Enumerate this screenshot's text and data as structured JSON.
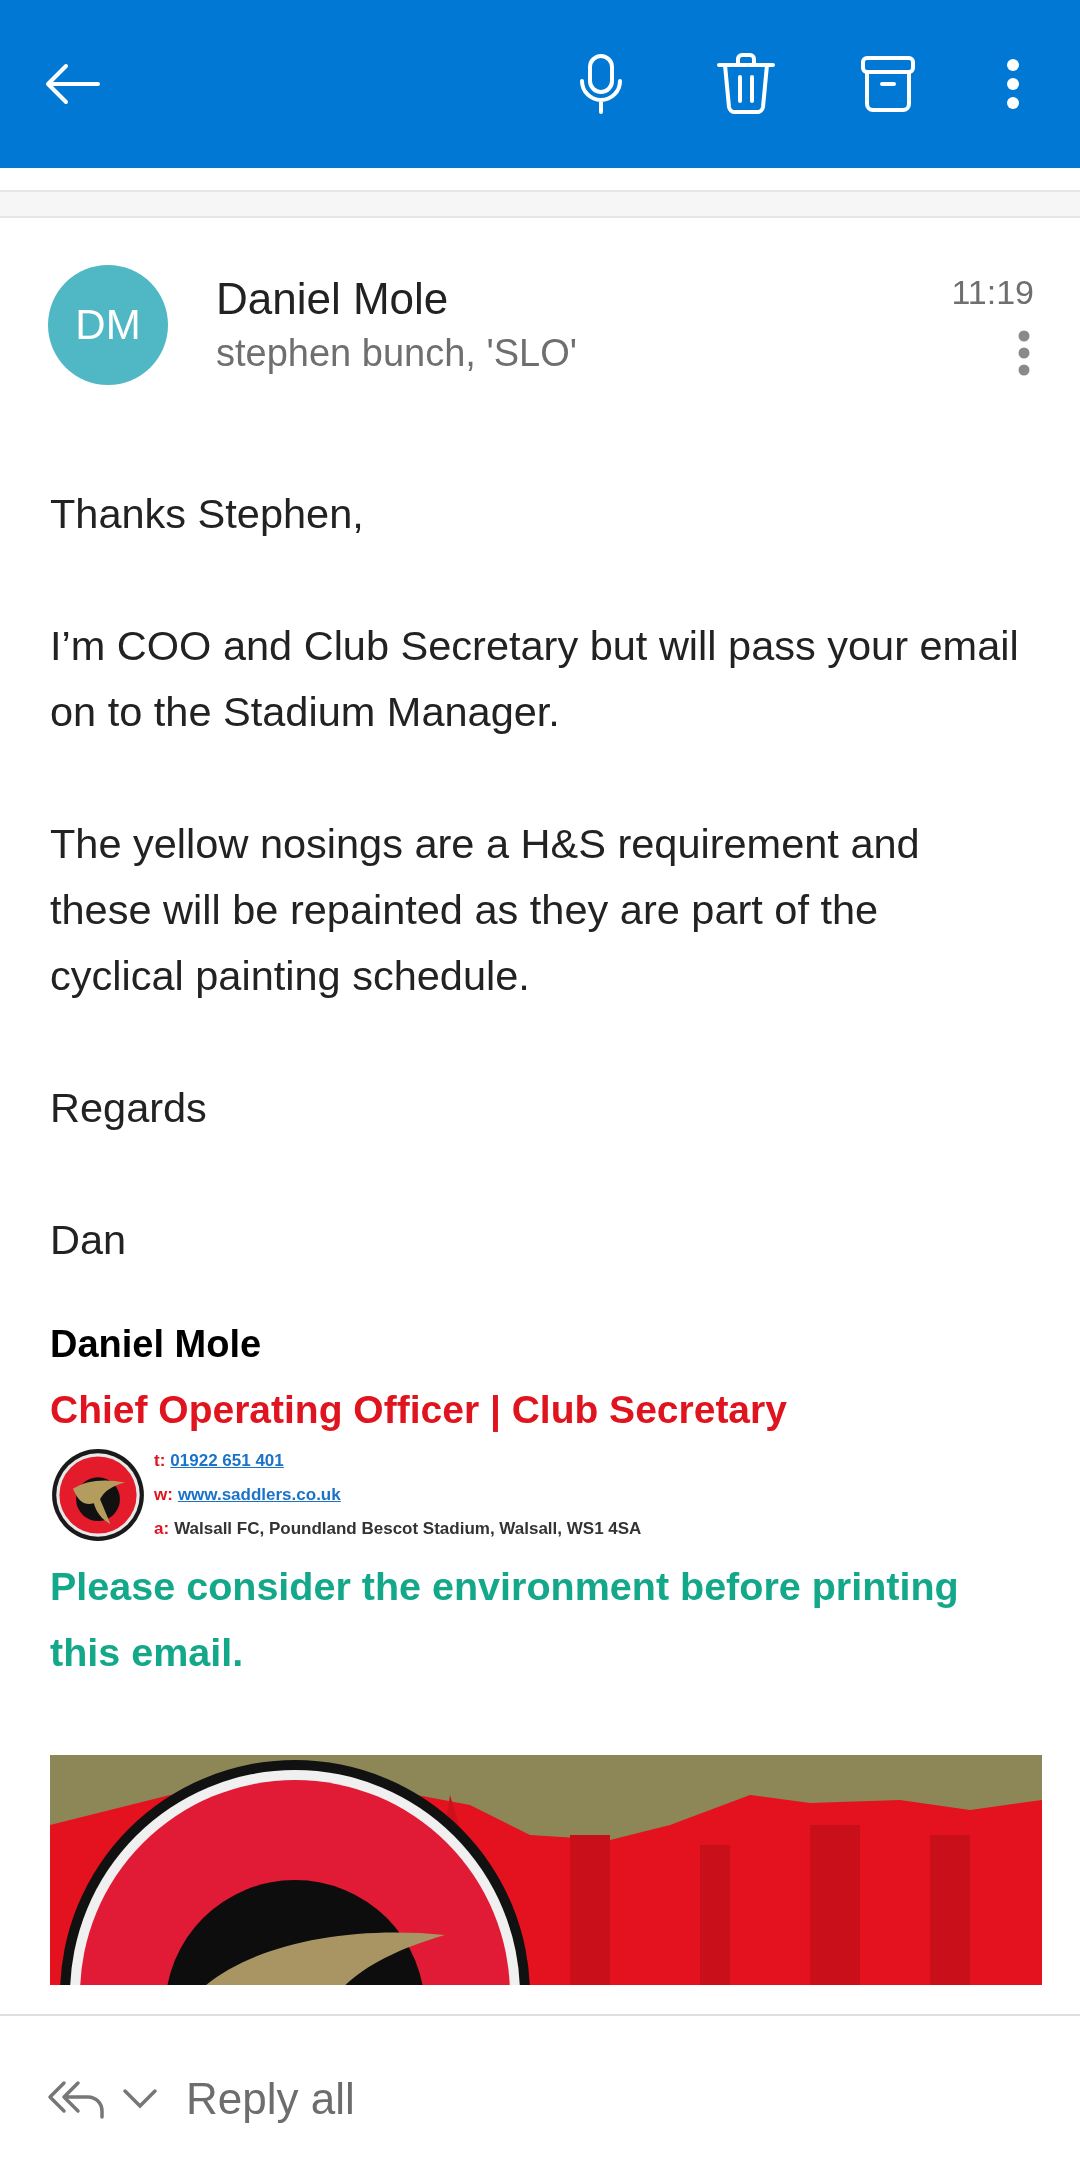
{
  "message": {
    "sender": "Daniel Mole",
    "initials": "DM",
    "recipients": "stephen bunch, 'SLO'",
    "time": "11:19"
  },
  "body": [
    "Thanks Stephen,",
    "I’m COO and Club Secretary but will pass your email on to the Stadium Manager.",
    "The yellow nosings are a H&S requirement and these will be repainted as they are part of the cyclical painting schedule.",
    "Regards",
    "Dan"
  ],
  "signature": {
    "name": "Daniel Mole",
    "title": "Chief Operating Officer | Club Secretary",
    "contacts": [
      {
        "label": "t:",
        "value": "01922 651 401",
        "kind": "link"
      },
      {
        "label": "w:",
        "value": "www.saddlers.co.uk",
        "kind": "link"
      },
      {
        "label": "a:",
        "value": "Walsall FC, Poundland Bescot Stadium, Walsall, WS1 4SA",
        "kind": "text"
      }
    ],
    "notice": "Please consider the environment before printing this email."
  },
  "footer": {
    "action": "Reply all"
  }
}
